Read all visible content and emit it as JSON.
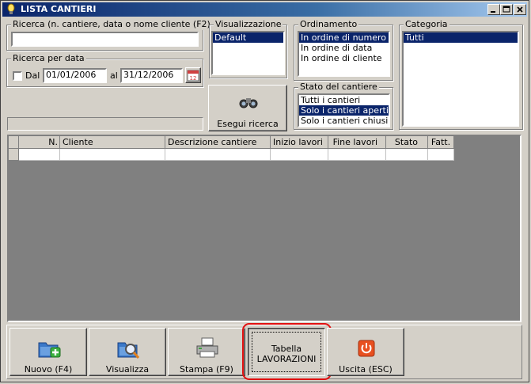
{
  "window": {
    "title": "LISTA CANTIERI"
  },
  "search": {
    "legend": "Ricerca (n. cantiere, data o nome cliente (F2)",
    "value": ""
  },
  "date_search": {
    "legend": "Ricerca per data",
    "dal_label": "Dal",
    "from": "01/01/2006",
    "al_label": "al",
    "to": "31/12/2006",
    "calendar_number": "12"
  },
  "view": {
    "legend": "Visualizzazione",
    "items": [
      "Default"
    ],
    "selected": 0
  },
  "order": {
    "legend": "Ordinamento",
    "items": [
      "In ordine di numero",
      "In ordine di data",
      "In ordine di cliente"
    ],
    "selected": 0
  },
  "state": {
    "legend": "Stato del cantiere",
    "items": [
      "Tutti i cantieri",
      "Solo i cantieri aperti",
      "Solo i cantieri chiusi"
    ],
    "selected": 1
  },
  "category": {
    "legend": "Categoria",
    "items": [
      "Tutti"
    ],
    "selected": 0
  },
  "run_search": {
    "label": "Esegui ricerca"
  },
  "table": {
    "columns": [
      "N.",
      "Cliente",
      "Descrizione cantiere",
      "Inizio lavori",
      "Fine lavori",
      "Stato",
      "Fatt."
    ]
  },
  "toolbar": {
    "new_label": "Nuovo (F4)",
    "view_label": "Visualizza",
    "print_label": "Stampa (F9)",
    "lav_line1": "Tabella",
    "lav_line2": "LAVORAZIONI",
    "exit_label": "Uscita (ESC)"
  },
  "colors": {
    "highlight": "#0a246a",
    "annotation": "#e01010",
    "exit_icon": "#e85020"
  }
}
